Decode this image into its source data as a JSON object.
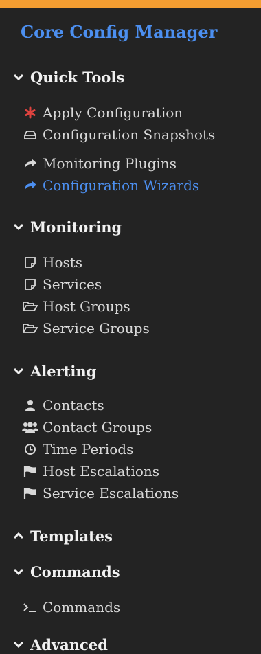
{
  "app_title": "Core Config Manager",
  "colors": {
    "accent": "#4c8ff0",
    "topbar": "#f49d31",
    "background": "#232323",
    "apply_icon": "#e0433f"
  },
  "sections": {
    "quick_tools": {
      "label": "Quick Tools",
      "expanded": true,
      "items": [
        {
          "label": "Apply Configuration",
          "icon": "asterisk-icon"
        },
        {
          "label": "Configuration Snapshots",
          "icon": "drive-icon"
        },
        {
          "label": "Monitoring Plugins",
          "icon": "share-arrow-icon"
        },
        {
          "label": "Configuration Wizards",
          "icon": "share-arrow-icon",
          "active": true
        }
      ]
    },
    "monitoring": {
      "label": "Monitoring",
      "expanded": true,
      "items": [
        {
          "label": "Hosts",
          "icon": "note-icon"
        },
        {
          "label": "Services",
          "icon": "note-icon"
        },
        {
          "label": "Host Groups",
          "icon": "folder-open-icon"
        },
        {
          "label": "Service Groups",
          "icon": "folder-open-icon"
        }
      ]
    },
    "alerting": {
      "label": "Alerting",
      "expanded": true,
      "items": [
        {
          "label": "Contacts",
          "icon": "user-icon"
        },
        {
          "label": "Contact Groups",
          "icon": "users-icon"
        },
        {
          "label": "Time Periods",
          "icon": "clock-icon"
        },
        {
          "label": "Host Escalations",
          "icon": "flag-icon"
        },
        {
          "label": "Service Escalations",
          "icon": "flag-icon"
        }
      ]
    },
    "templates": {
      "label": "Templates",
      "expanded": false
    },
    "commands": {
      "label": "Commands",
      "expanded": true,
      "items": [
        {
          "label": "Commands",
          "icon": "terminal-icon"
        }
      ]
    },
    "advanced": {
      "label": "Advanced"
    }
  }
}
